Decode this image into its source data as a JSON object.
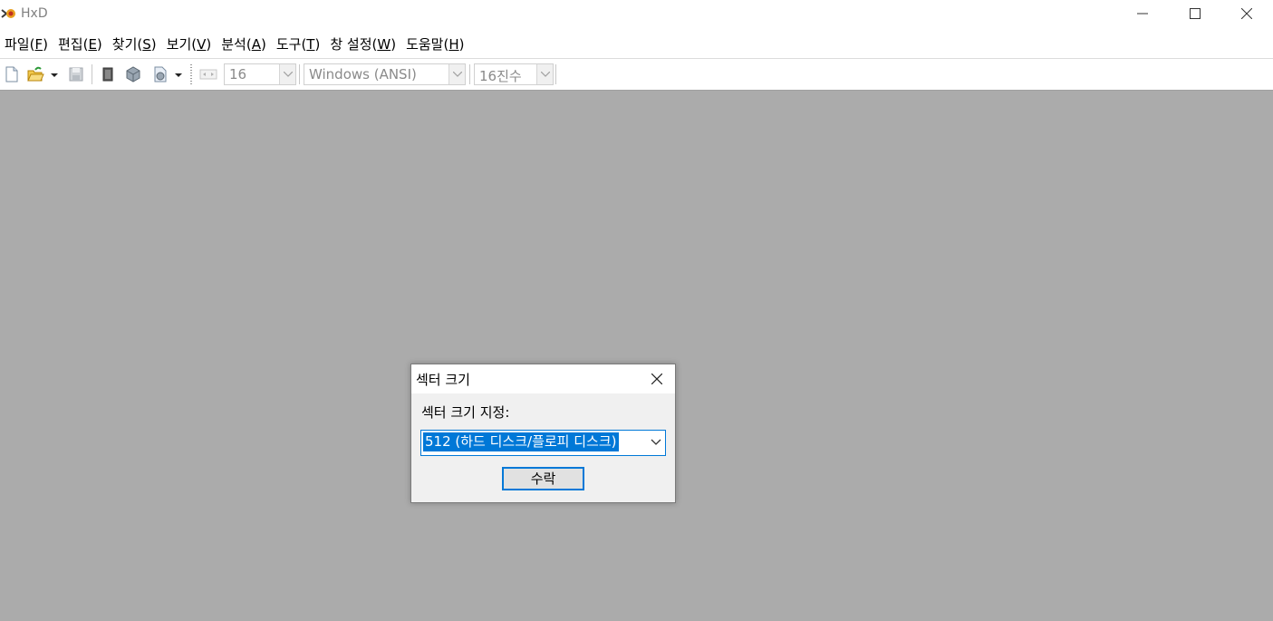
{
  "window": {
    "title": "HxD"
  },
  "menu": {
    "items": [
      {
        "label": "파일",
        "accel": "F"
      },
      {
        "label": "편집",
        "accel": "E"
      },
      {
        "label": "찾기",
        "accel": "S"
      },
      {
        "label": "보기",
        "accel": "V"
      },
      {
        "label": "분석",
        "accel": "A"
      },
      {
        "label": "도구",
        "accel": "T"
      },
      {
        "label": "창 설정",
        "accel": "W"
      },
      {
        "label": "도움말",
        "accel": "H"
      }
    ]
  },
  "toolbar": {
    "bytes_per_row": "16",
    "charset": "Windows (ANSI)",
    "offset_base": "16진수"
  },
  "dialog": {
    "title": "섹터 크기",
    "label": "섹터 크기 지정:",
    "selected_option": "512 (하드 디스크/플로피 디스크)",
    "ok_label": "수락"
  },
  "colors": {
    "workspace": "#ababab",
    "accent": "#0078d7",
    "dialog_bg": "#f0f0f0"
  },
  "icons": [
    "hxd-app-icon",
    "minimize-icon",
    "maximize-icon",
    "close-icon",
    "new-file-icon",
    "open-folder-icon",
    "dropdown-arrow-icon",
    "save-icon",
    "ram-icon",
    "disk-icon",
    "open-disk-image-icon",
    "chevron-down-icon"
  ]
}
